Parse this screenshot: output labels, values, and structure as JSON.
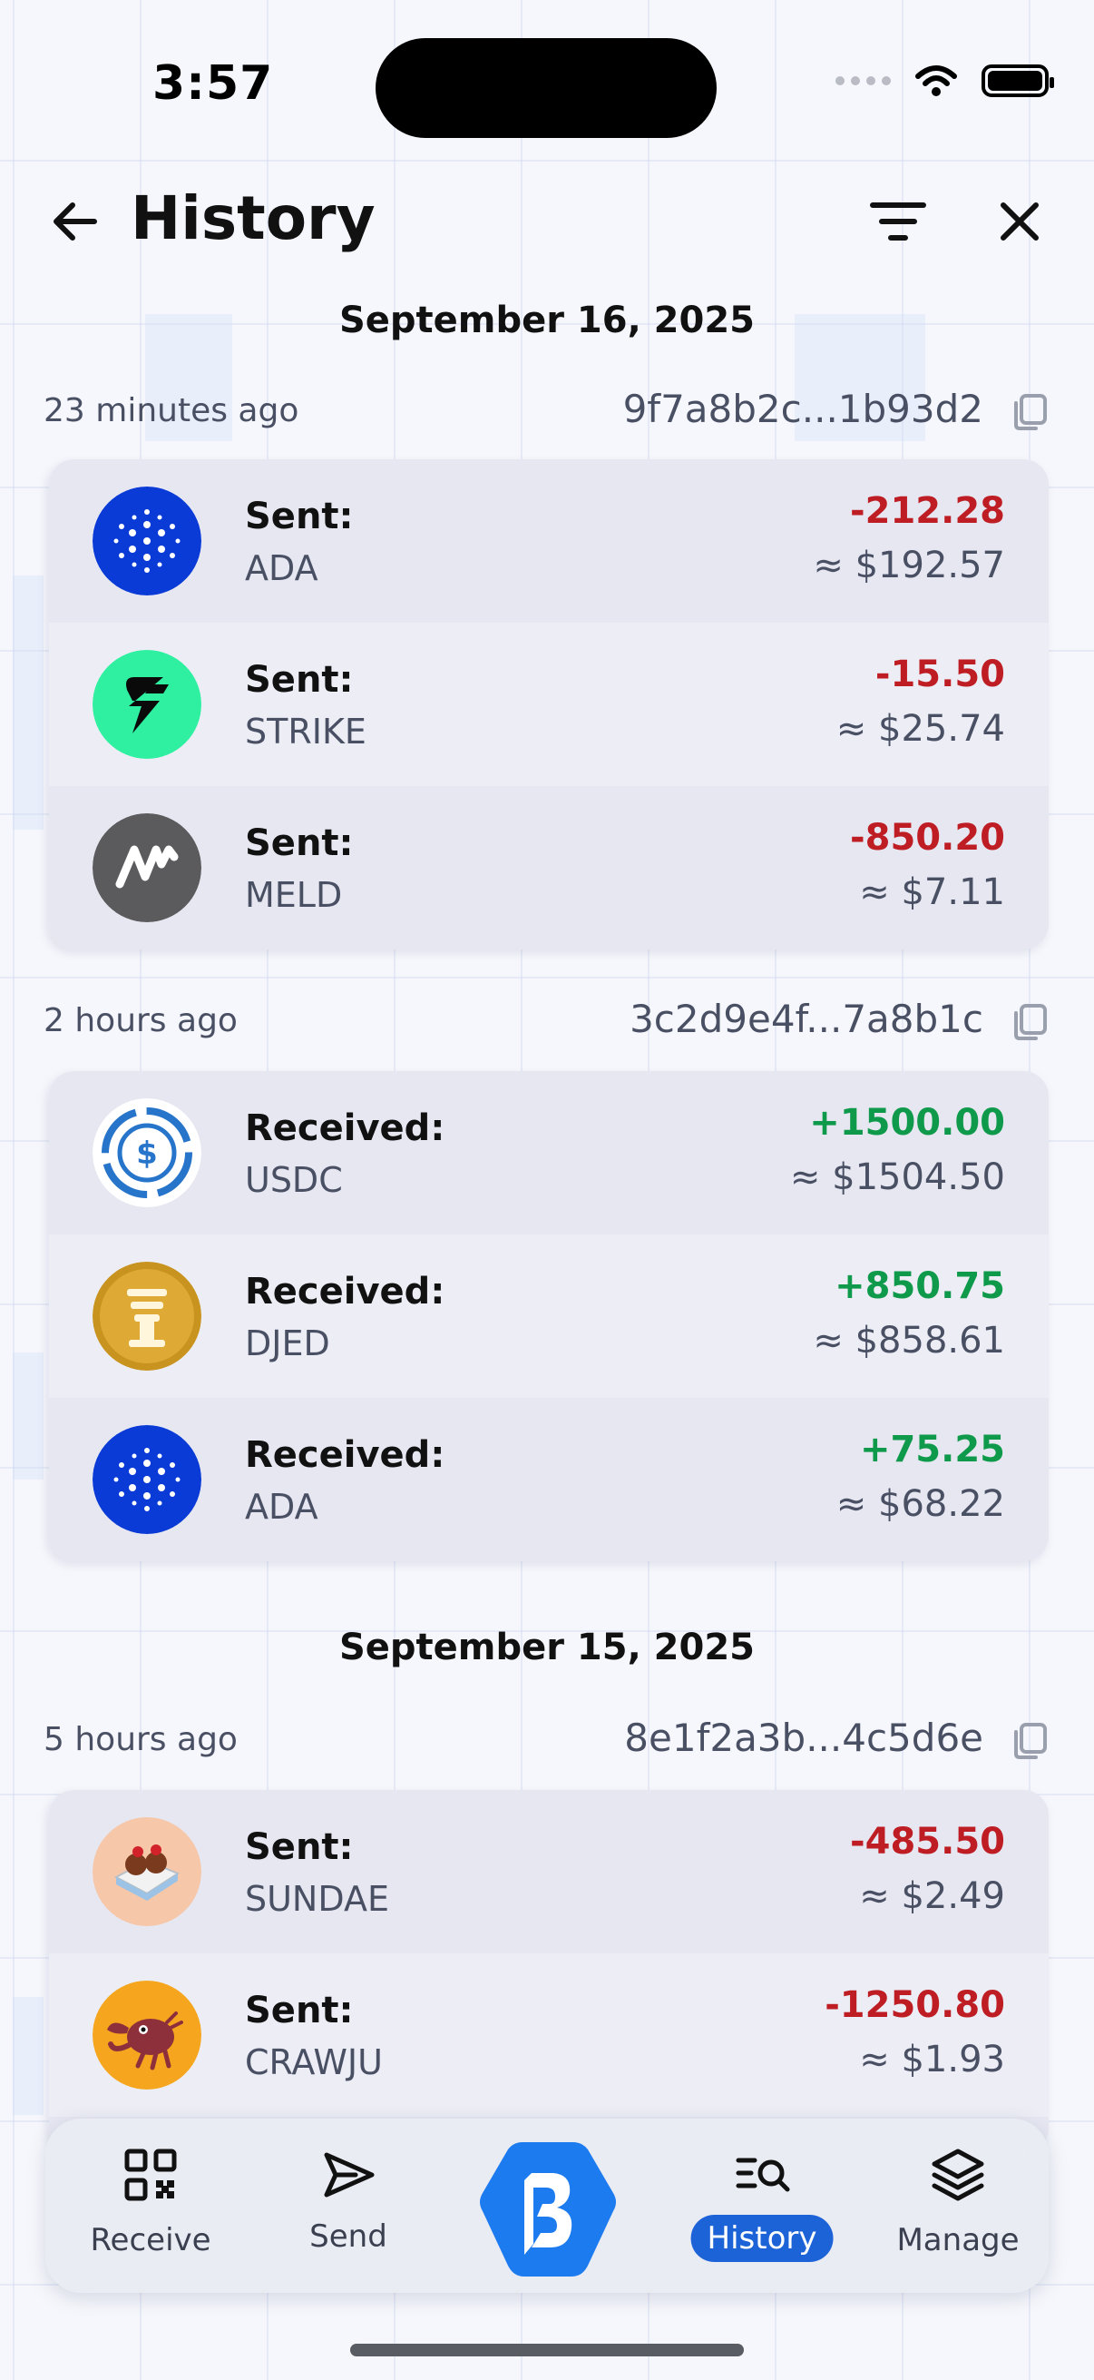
{
  "status_bar": {
    "time": "3:57"
  },
  "header": {
    "title": "History"
  },
  "nav": {
    "receive": "Receive",
    "send": "Send",
    "history": "History",
    "manage": "Manage"
  },
  "dates": [
    "September 16, 2025",
    "September 15, 2025"
  ],
  "groups": [
    {
      "time_ago": "23 minutes ago",
      "hash": "9f7a8b2c...1b93d2",
      "rows": [
        {
          "action": "Sent:",
          "symbol": "ADA",
          "amount": "-212.28",
          "fiat": "≈ $192.57",
          "icon": "cardano-icon"
        },
        {
          "action": "Sent:",
          "symbol": "STRIKE",
          "amount": "-15.50",
          "fiat": "≈ $25.74",
          "icon": "strike-icon"
        },
        {
          "action": "Sent:",
          "symbol": "MELD",
          "amount": "-850.20",
          "fiat": "≈ $7.11",
          "icon": "meld-icon"
        }
      ]
    },
    {
      "time_ago": "2 hours ago",
      "hash": "3c2d9e4f...7a8b1c",
      "rows": [
        {
          "action": "Received:",
          "symbol": "USDC",
          "amount": "+1500.00",
          "fiat": "≈ $1504.50",
          "icon": "usdc-icon"
        },
        {
          "action": "Received:",
          "symbol": "DJED",
          "amount": "+850.75",
          "fiat": "≈ $858.61",
          "icon": "djed-icon"
        },
        {
          "action": "Received:",
          "symbol": "ADA",
          "amount": "+75.25",
          "fiat": "≈ $68.22",
          "icon": "cardano-icon"
        }
      ]
    },
    {
      "time_ago": "5 hours ago",
      "hash": "8e1f2a3b...4c5d6e",
      "rows": [
        {
          "action": "Sent:",
          "symbol": "SUNDAE",
          "amount": "-485.50",
          "fiat": "≈ $2.49",
          "icon": "sundae-icon"
        },
        {
          "action": "Sent:",
          "symbol": "CRAWJU",
          "amount": "-1250.80",
          "fiat": "≈ $1.93",
          "icon": "crawju-icon"
        }
      ]
    }
  ],
  "colors": {
    "negative": "#bf1d24",
    "positive": "#0f9a4b",
    "accent": "#1d63d8"
  }
}
